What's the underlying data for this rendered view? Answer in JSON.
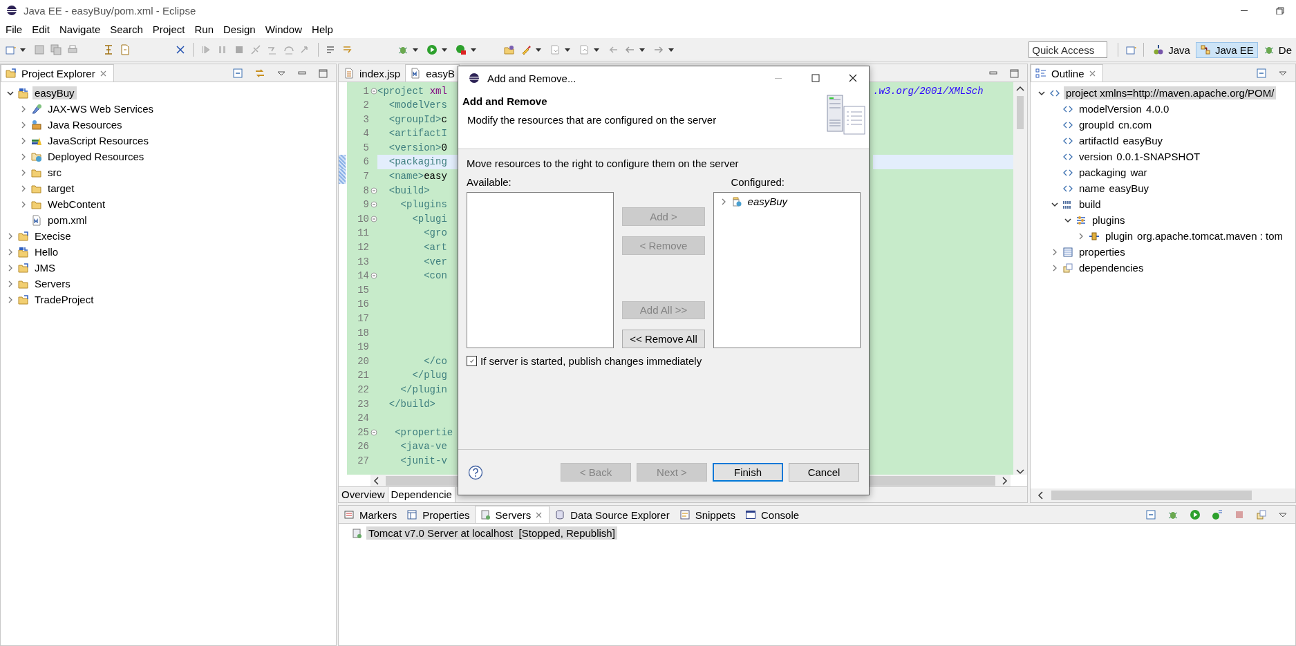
{
  "window": {
    "title": "Java EE - easyBuy/pom.xml - Eclipse"
  },
  "menu": [
    "File",
    "Edit",
    "Navigate",
    "Search",
    "Project",
    "Run",
    "Design",
    "Window",
    "Help"
  ],
  "quick_access": {
    "placeholder": "Quick Access"
  },
  "perspectives": [
    {
      "label": "Java",
      "selected": false,
      "kind": "java"
    },
    {
      "label": "Java EE",
      "selected": true,
      "kind": "javaee"
    },
    {
      "label": "De",
      "selected": false,
      "kind": "debug"
    }
  ],
  "project_explorer": {
    "title": "Project Explorer",
    "items": [
      {
        "label": "easyBuy",
        "kind": "maven-project",
        "expandable": true,
        "expanded": true,
        "selected": true,
        "children": [
          {
            "label": "JAX-WS Web Services",
            "kind": "webservice",
            "expandable": true,
            "expanded": false,
            "selected": false
          },
          {
            "label": "Java Resources",
            "kind": "java-resources",
            "expandable": true,
            "expanded": false,
            "selected": false
          },
          {
            "label": "JavaScript Resources",
            "kind": "js-resources",
            "expandable": true,
            "expanded": false,
            "selected": false
          },
          {
            "label": "Deployed Resources",
            "kind": "deployed",
            "expandable": true,
            "expanded": false,
            "selected": false
          },
          {
            "label": "src",
            "kind": "folder",
            "expandable": true,
            "expanded": false,
            "selected": false
          },
          {
            "label": "target",
            "kind": "folder",
            "expandable": true,
            "expanded": false,
            "selected": false
          },
          {
            "label": "WebContent",
            "kind": "folder",
            "expandable": true,
            "expanded": false,
            "selected": false
          },
          {
            "label": "pom.xml",
            "kind": "maven-file",
            "expandable": false,
            "expanded": false,
            "selected": false
          }
        ]
      },
      {
        "label": "Execise",
        "kind": "project",
        "expandable": true,
        "expanded": false,
        "selected": false
      },
      {
        "label": "Hello",
        "kind": "maven-project",
        "expandable": true,
        "expanded": false,
        "selected": false
      },
      {
        "label": "JMS",
        "kind": "project",
        "expandable": true,
        "expanded": false,
        "selected": false
      },
      {
        "label": "Servers",
        "kind": "folder",
        "expandable": true,
        "expanded": false,
        "selected": false
      },
      {
        "label": "TradeProject",
        "kind": "project",
        "expandable": true,
        "expanded": false,
        "selected": false
      }
    ]
  },
  "editor": {
    "tabs": [
      {
        "label": "index.jsp",
        "kind": "jsp",
        "selected": false
      },
      {
        "label": "easyB",
        "kind": "maven-file",
        "selected": true
      }
    ],
    "lines": [
      {
        "number": "1",
        "fold": true,
        "current": false,
        "changed": false,
        "parts": [
          {
            "kind": "tag",
            "text": "<project "
          },
          {
            "kind": "attr",
            "text": "xml"
          }
        ],
        "tail": [
          {
            "kind": "uri",
            "text": ".w3.org/2001/XMLSch"
          }
        ]
      },
      {
        "number": "2",
        "fold": false,
        "current": false,
        "changed": false,
        "parts": [
          {
            "kind": "tag",
            "text": "  <modelVers"
          }
        ]
      },
      {
        "number": "3",
        "fold": false,
        "current": false,
        "changed": false,
        "parts": [
          {
            "kind": "tag",
            "text": "  <groupId>"
          },
          {
            "kind": "text",
            "text": "c"
          }
        ]
      },
      {
        "number": "4",
        "fold": false,
        "current": false,
        "changed": false,
        "parts": [
          {
            "kind": "tag",
            "text": "  <artifactI"
          }
        ]
      },
      {
        "number": "5",
        "fold": false,
        "current": false,
        "changed": false,
        "parts": [
          {
            "kind": "tag",
            "text": "  <version>"
          },
          {
            "kind": "text",
            "text": "0"
          }
        ]
      },
      {
        "number": "6",
        "fold": false,
        "current": true,
        "changed": true,
        "parts": [
          {
            "kind": "tag",
            "text": "  <packaging"
          }
        ]
      },
      {
        "number": "7",
        "fold": false,
        "current": false,
        "changed": true,
        "parts": [
          {
            "kind": "tag",
            "text": "  <name>"
          },
          {
            "kind": "text",
            "text": "easy"
          }
        ]
      },
      {
        "number": "8",
        "fold": true,
        "current": false,
        "changed": false,
        "parts": [
          {
            "kind": "tag",
            "text": "  <build>"
          }
        ]
      },
      {
        "number": "9",
        "fold": true,
        "current": false,
        "changed": false,
        "parts": [
          {
            "kind": "tag",
            "text": "    <plugins"
          }
        ]
      },
      {
        "number": "10",
        "fold": true,
        "current": false,
        "changed": false,
        "parts": [
          {
            "kind": "tag",
            "text": "      <plugi"
          }
        ]
      },
      {
        "number": "11",
        "fold": false,
        "current": false,
        "changed": false,
        "parts": [
          {
            "kind": "tag",
            "text": "        <gro"
          }
        ]
      },
      {
        "number": "12",
        "fold": false,
        "current": false,
        "changed": false,
        "parts": [
          {
            "kind": "tag",
            "text": "        <art"
          }
        ]
      },
      {
        "number": "13",
        "fold": false,
        "current": false,
        "changed": false,
        "parts": [
          {
            "kind": "tag",
            "text": "        <ver"
          }
        ]
      },
      {
        "number": "14",
        "fold": true,
        "current": false,
        "changed": false,
        "parts": [
          {
            "kind": "tag",
            "text": "        <con"
          }
        ]
      },
      {
        "number": "15",
        "fold": false,
        "current": false,
        "changed": false
      },
      {
        "number": "16",
        "fold": false,
        "current": false,
        "changed": false
      },
      {
        "number": "17",
        "fold": false,
        "current": false,
        "changed": false
      },
      {
        "number": "18",
        "fold": false,
        "current": false,
        "changed": false
      },
      {
        "number": "19",
        "fold": false,
        "current": false,
        "changed": false
      },
      {
        "number": "20",
        "fold": false,
        "current": false,
        "changed": false,
        "parts": [
          {
            "kind": "tag",
            "text": "        </co"
          }
        ]
      },
      {
        "number": "21",
        "fold": false,
        "current": false,
        "changed": false,
        "parts": [
          {
            "kind": "tag",
            "text": "      </plug"
          }
        ]
      },
      {
        "number": "22",
        "fold": false,
        "current": false,
        "changed": false,
        "parts": [
          {
            "kind": "tag",
            "text": "    </plugin"
          }
        ]
      },
      {
        "number": "23",
        "fold": false,
        "current": false,
        "changed": false,
        "parts": [
          {
            "kind": "tag",
            "text": "  </build>"
          }
        ]
      },
      {
        "number": "24",
        "fold": false,
        "current": false,
        "changed": false
      },
      {
        "number": "25",
        "fold": true,
        "current": false,
        "changed": false,
        "parts": [
          {
            "kind": "tag",
            "text": "   <propertie"
          }
        ]
      },
      {
        "number": "26",
        "fold": false,
        "current": false,
        "changed": false,
        "parts": [
          {
            "kind": "tag",
            "text": "    <java-ve"
          }
        ]
      },
      {
        "number": "27",
        "fold": false,
        "current": false,
        "changed": false,
        "parts": [
          {
            "kind": "tag",
            "text": "    <junit-v"
          }
        ]
      }
    ],
    "bottom_tabs": [
      {
        "label": "Overview",
        "selected": false
      },
      {
        "label": "Dependencie",
        "selected": true
      }
    ]
  },
  "outline": {
    "title": "Outline",
    "items": [
      {
        "name": "project xmlns=http://maven.apache.org/POM/",
        "kind": "element",
        "expandable": true,
        "expanded": true,
        "selected": true,
        "children": [
          {
            "name": "modelVersion",
            "value": "4.0.0",
            "kind": "element",
            "expandable": false,
            "expanded": false,
            "selected": false
          },
          {
            "name": "groupId",
            "value": "cn.com",
            "kind": "element",
            "expandable": false,
            "expanded": false,
            "selected": false
          },
          {
            "name": "artifactId",
            "value": "easyBuy",
            "kind": "element",
            "expandable": false,
            "expanded": false,
            "selected": false
          },
          {
            "name": "version",
            "value": "0.0.1-SNAPSHOT",
            "kind": "element",
            "expandable": false,
            "expanded": false,
            "selected": false
          },
          {
            "name": "packaging",
            "value": "war",
            "kind": "element",
            "expandable": false,
            "expanded": false,
            "selected": false
          },
          {
            "name": "name",
            "value": "easyBuy",
            "kind": "element",
            "expandable": false,
            "expanded": false,
            "selected": false
          },
          {
            "name": "build",
            "kind": "build",
            "expandable": true,
            "expanded": true,
            "selected": false,
            "children": [
              {
                "name": "plugins",
                "kind": "plugins",
                "expandable": true,
                "expanded": true,
                "selected": false,
                "children": [
                  {
                    "name": "plugin",
                    "value": "org.apache.tomcat.maven : tom",
                    "kind": "plugin",
                    "expandable": true,
                    "expanded": false,
                    "selected": false
                  }
                ]
              }
            ]
          },
          {
            "name": "properties",
            "kind": "properties",
            "expandable": true,
            "expanded": false,
            "selected": false
          },
          {
            "name": "dependencies",
            "kind": "dependencies",
            "expandable": true,
            "expanded": false,
            "selected": false
          }
        ]
      }
    ]
  },
  "bottom_panel": {
    "tabs": [
      {
        "label": "Markers",
        "kind": "markers",
        "selected": false
      },
      {
        "label": "Properties",
        "kind": "properties",
        "selected": false
      },
      {
        "label": "Servers",
        "kind": "servers",
        "selected": true
      },
      {
        "label": "Data Source Explorer",
        "kind": "datasource",
        "selected": false
      },
      {
        "label": "Snippets",
        "kind": "snippets",
        "selected": false
      },
      {
        "label": "Console",
        "kind": "console",
        "selected": false
      }
    ],
    "servers": [
      {
        "name": "Tomcat v7.0 Server at localhost",
        "status": "[Stopped, Republish]",
        "selected": true
      }
    ]
  },
  "dialog": {
    "title": "Add and Remove...",
    "heading": "Add and Remove",
    "description": "Modify the resources that are configured on the server",
    "instruction": "Move resources to the right to configure them on the server",
    "available": {
      "label": "Available:"
    },
    "configured": {
      "label": "Configured:",
      "items": [
        {
          "label": "easyBuy",
          "expanded": false
        }
      ]
    },
    "move_buttons": [
      {
        "label": "Add >",
        "disabled": true
      },
      {
        "label": "< Remove",
        "disabled": true
      },
      {
        "label": "Add All >>",
        "disabled": true
      },
      {
        "label": "<< Remove All",
        "disabled": false
      }
    ],
    "publish": {
      "label": "If server is started, publish changes immediately",
      "checked": true
    },
    "footer_buttons": [
      {
        "label": "< Back",
        "disabled": true,
        "default": false
      },
      {
        "label": "Next >",
        "disabled": true,
        "default": false
      },
      {
        "label": "Finish",
        "disabled": false,
        "default": true
      },
      {
        "label": "Cancel",
        "disabled": false,
        "default": false
      }
    ]
  }
}
